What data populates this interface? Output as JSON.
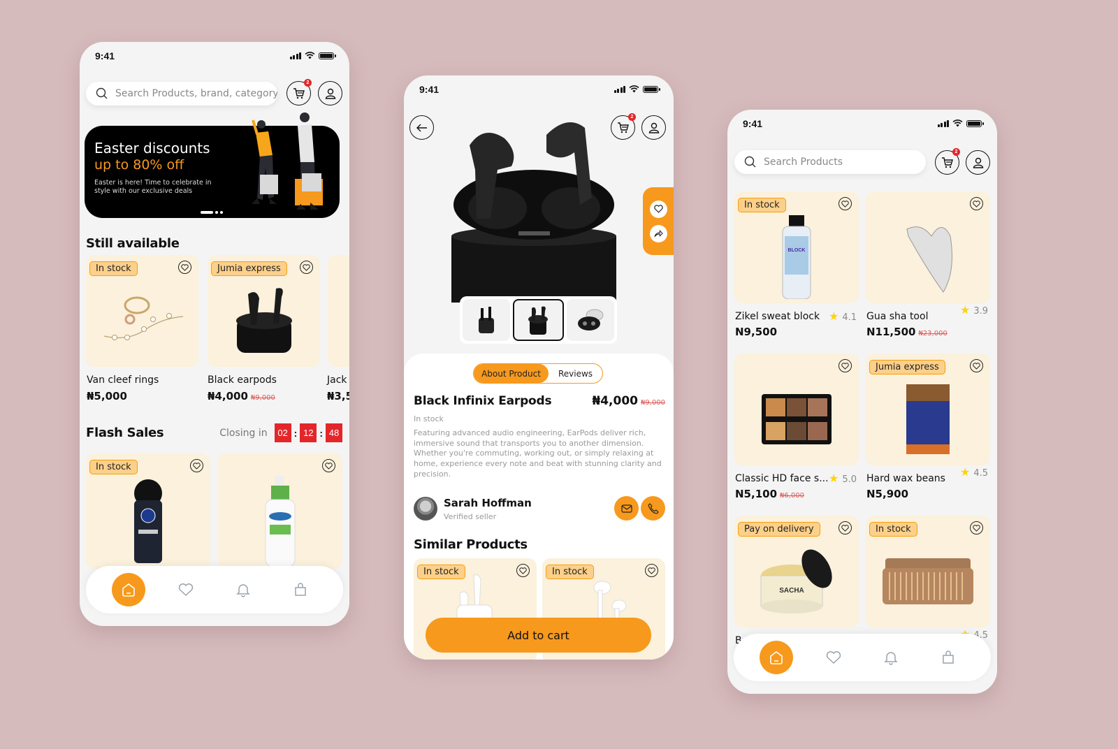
{
  "background_color": "#d6bbbd",
  "accent_color": "#f7991d",
  "status_bar": {
    "time": "9:41"
  },
  "phone_home": {
    "search_placeholder": "Search Products, brand, category",
    "cart_badge": "2",
    "banner": {
      "title": "Easter discounts",
      "subtitle": "up to 80% off",
      "description": "Easter is here! Time to celebrate in style with our exclusive deals",
      "carousel_pages": 3,
      "active_page": 1
    },
    "still_available": {
      "title": "Still available",
      "items": [
        {
          "tag": "In stock",
          "name": "Van cleef rings",
          "price": "₦5,000",
          "old_price": ""
        },
        {
          "tag": "Jumia express",
          "name": "Black earpods",
          "price": "₦4,000",
          "old_price": "₦9,000"
        },
        {
          "tag": "",
          "name": "Jack",
          "price": "₦3,5",
          "old_price": ""
        }
      ]
    },
    "flash_sales": {
      "title": "Flash Sales",
      "closing_label": "Closing in",
      "timer": [
        "02",
        "12",
        "48"
      ],
      "items": [
        {
          "tag": "In stock",
          "product": "Nivea Men Deep roll-on"
        },
        {
          "tag": "",
          "product": "Cetaphil facial moisturizer"
        }
      ]
    },
    "nav": [
      "home",
      "favorites",
      "notifications",
      "bag"
    ]
  },
  "phone_detail": {
    "cart_badge": "2",
    "tabs": {
      "active": "About Product",
      "inactive": "Reviews"
    },
    "title": "Black Infinix Earpods",
    "price": "₦4,000",
    "old_price": "₦9,000",
    "stock": "In stock",
    "description": "Featuring advanced audio engineering, EarPods deliver rich, immersive sound that transports you to another dimension. Whether you're commuting, working out, or simply relaxing at home, experience every note and beat with stunning clarity and precision.",
    "seller": {
      "name": "Sarah Hoffman",
      "role": "Verified seller"
    },
    "similar_title": "Similar Products",
    "similar_items": [
      {
        "tag": "In stock"
      },
      {
        "tag": "In stock"
      }
    ],
    "add_to_cart": "Add to cart"
  },
  "phone_grid": {
    "search_placeholder": "Search Products",
    "cart_badge": "2",
    "items": [
      {
        "tag": "In stock",
        "name": "Zikel sweat block",
        "rating": "4.1",
        "price": "N9,500",
        "old_price": ""
      },
      {
        "tag": "",
        "name": "Gua sha tool",
        "rating": "3.9",
        "price": "N11,500",
        "old_price": "₦23,000"
      },
      {
        "tag": "",
        "name": "Classic HD face s...",
        "rating": "5.0",
        "price": "N5,100",
        "old_price": "₦6,000"
      },
      {
        "tag": "Jumia express",
        "name": "Hard wax beans",
        "rating": "4.5",
        "price": "N5,900",
        "old_price": ""
      },
      {
        "tag": "Pay on delivery",
        "name": "B",
        "rating": "",
        "price": "",
        "old_price": ""
      },
      {
        "tag": "In stock",
        "name": "",
        "rating": "4.5",
        "price": "",
        "old_price": ""
      }
    ]
  }
}
